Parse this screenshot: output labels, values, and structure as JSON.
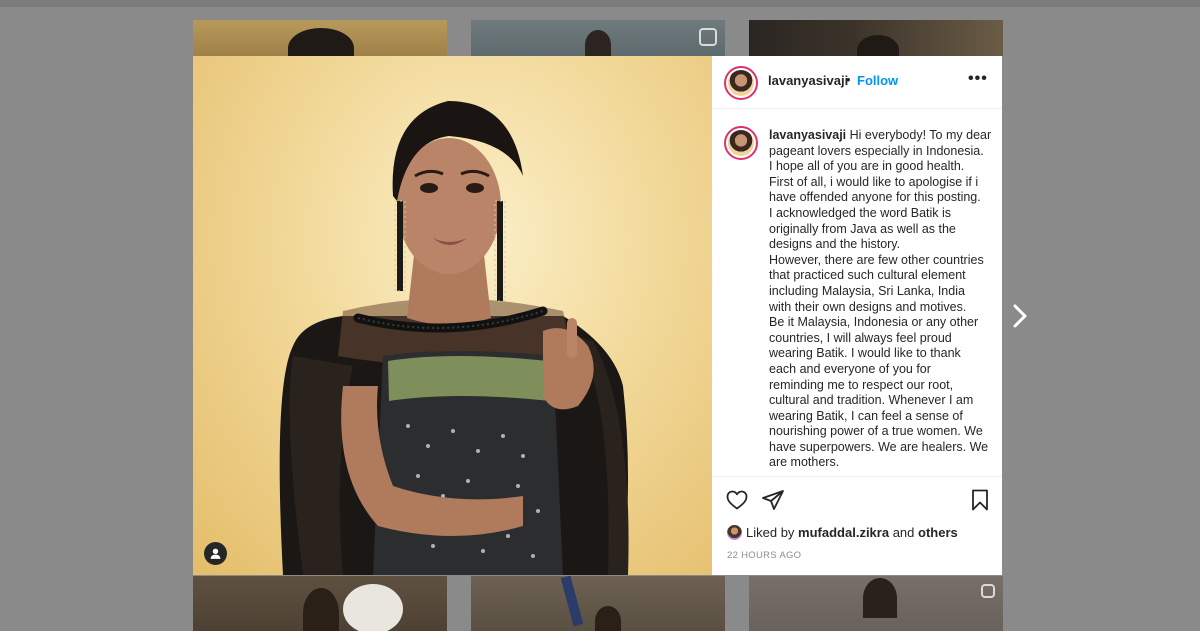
{
  "post": {
    "username": "lavanyasivaji",
    "separator": "•",
    "follow_label": "Follow",
    "more_icon": "more-horizontal-icon",
    "caption_lines": [
      "Hi everybody! To my dear",
      "pageant lovers especially in Indonesia.",
      "I hope all of you are in good health.",
      "First of all, i would like to apologise if i",
      "have offended anyone for this posting.",
      "I acknowledged the word Batik is",
      "originally from Java as well as the",
      "designs and the history.",
      "However, there are few other countries",
      "that practiced such cultural element",
      "including Malaysia, Sri Lanka, India",
      "with their own designs and motives.",
      "Be it Malaysia, Indonesia or any other",
      "countries, I will always feel proud",
      "wearing Batik. I would like to thank",
      "each and everyone of you for",
      "reminding me to respect our root,",
      "cultural and tradition. Whenever I am",
      "wearing Batik, I can feel a sense of",
      "nourishing power of a true women. We",
      "have superpowers. We are healers. We",
      "are mothers."
    ],
    "likes": {
      "prefix": "Liked by",
      "user": "mufaddal.zikra",
      "conjunction": "and",
      "others": "others"
    },
    "timestamp": "22 HOURS AGO"
  },
  "icons": {
    "like": "heart-icon",
    "share": "paper-plane-icon",
    "save": "bookmark-icon",
    "tags": "user-tag-icon",
    "next": "chevron-right-icon"
  },
  "colors": {
    "accent": "#0095f6",
    "text": "#262626",
    "muted": "#8e8e8e",
    "backdrop": "#8a8a8a"
  }
}
